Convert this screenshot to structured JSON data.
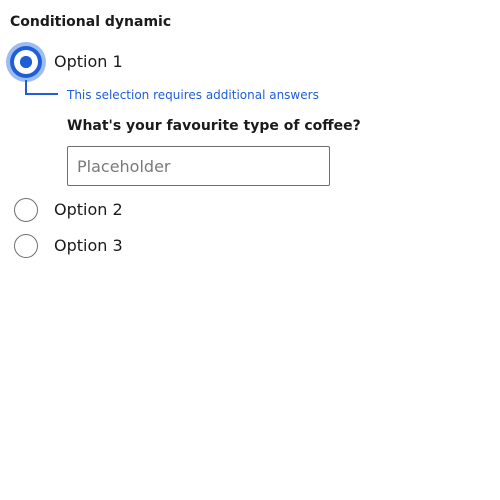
{
  "form": {
    "group_label": "Conditional dynamic",
    "options": [
      {
        "label": "Option 1",
        "selected": true
      },
      {
        "label": "Option 2",
        "selected": false
      },
      {
        "label": "Option 3",
        "selected": false
      }
    ],
    "conditional": {
      "hint": "This selection requires additional answers",
      "question_label": "What's your favourite type of coffee?",
      "input_value": "",
      "input_placeholder": "Placeholder"
    }
  },
  "colors": {
    "accent": "#1f5fd6",
    "focus_ring": "#9dbcf2",
    "border": "#6f6f6f",
    "text": "#1b1b1b"
  }
}
